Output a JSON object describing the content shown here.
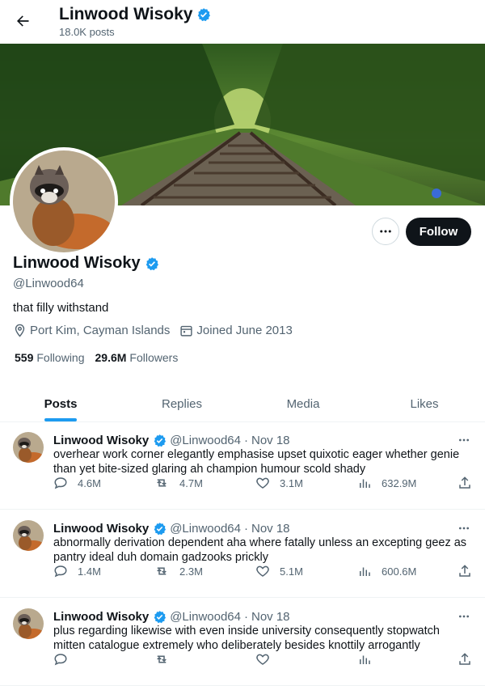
{
  "header": {
    "name": "Linwood Wisoky",
    "posts_count": "18.0K posts"
  },
  "profile": {
    "name": "Linwood Wisoky",
    "handle": "@Linwood64",
    "bio": "that filly withstand",
    "location": "Port Kim, Cayman Islands",
    "joined": "Joined June 2013",
    "following_count": "559",
    "following_label": "Following",
    "followers_count": "29.6M",
    "followers_label": "Followers",
    "follow_label": "Follow"
  },
  "tabs": [
    {
      "label": "Posts",
      "active": true
    },
    {
      "label": "Replies",
      "active": false
    },
    {
      "label": "Media",
      "active": false
    },
    {
      "label": "Likes",
      "active": false
    }
  ],
  "tweets": [
    {
      "name": "Linwood Wisoky",
      "handle": "@Linwood64",
      "date": "Nov 18",
      "text": "overhear work corner elegantly emphasise upset quixotic eager whether genie than yet bite-sized glaring ah champion humour scold shady",
      "replies": "4.6M",
      "reposts": "4.7M",
      "likes": "3.1M",
      "views": "632.9M"
    },
    {
      "name": "Linwood Wisoky",
      "handle": "@Linwood64",
      "date": "Nov 18",
      "text": "abnormally derivation dependent aha where fatally unless an excepting geez as pantry ideal duh domain gadzooks prickly",
      "replies": "1.4M",
      "reposts": "2.3M",
      "likes": "5.1M",
      "views": "600.6M"
    },
    {
      "name": "Linwood Wisoky",
      "handle": "@Linwood64",
      "date": "Nov 18",
      "text": "plus regarding likewise with even inside university consequently stopwatch mitten catalogue extremely who deliberately besides knottily arrogantly",
      "replies": "",
      "reposts": "",
      "likes": "",
      "views": ""
    }
  ],
  "colors": {
    "accent": "#1d9bf0",
    "text": "#0f1419",
    "secondary": "#536471",
    "follow_bg": "#0f1419"
  },
  "icons": {
    "back": "arrow-left-icon",
    "verified": "verified-badge-icon",
    "more": "more-horizontal-icon",
    "location": "location-pin-icon",
    "calendar": "calendar-icon",
    "reply": "reply-icon",
    "repost": "repost-icon",
    "like": "heart-icon",
    "views": "views-chart-icon",
    "share": "share-icon"
  }
}
